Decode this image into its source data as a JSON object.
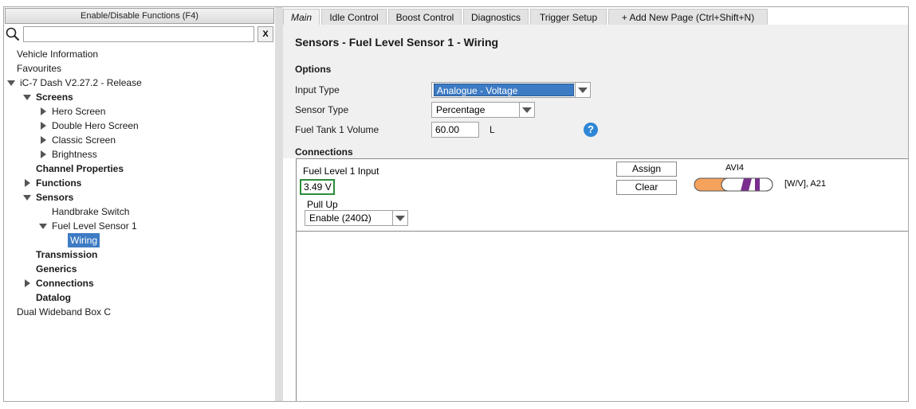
{
  "left_panel": {
    "enable_button": "Enable/Disable Functions (F4)",
    "search": {
      "value": "",
      "placeholder": ""
    },
    "clear_label": "X",
    "tree": [
      {
        "label": "Vehicle Information",
        "bold": false,
        "level": 0,
        "toggle": "none"
      },
      {
        "label": "Favourites",
        "bold": false,
        "level": 0,
        "toggle": "none"
      },
      {
        "label": "iC-7 Dash V2.27.2 - Release",
        "bold": false,
        "level": 0,
        "toggle": "expanded"
      },
      {
        "label": "Screens",
        "bold": true,
        "level": 1,
        "toggle": "expanded"
      },
      {
        "label": "Hero Screen",
        "bold": false,
        "level": 2,
        "toggle": "collapsed"
      },
      {
        "label": "Double Hero Screen",
        "bold": false,
        "level": 2,
        "toggle": "collapsed"
      },
      {
        "label": "Classic Screen",
        "bold": false,
        "level": 2,
        "toggle": "collapsed"
      },
      {
        "label": "Brightness",
        "bold": false,
        "level": 2,
        "toggle": "collapsed"
      },
      {
        "label": "Channel Properties",
        "bold": true,
        "level": 1,
        "toggle": "none"
      },
      {
        "label": "Functions",
        "bold": true,
        "level": 1,
        "toggle": "collapsed"
      },
      {
        "label": "Sensors",
        "bold": true,
        "level": 1,
        "toggle": "expanded"
      },
      {
        "label": "Handbrake Switch",
        "bold": false,
        "level": 2,
        "toggle": "none"
      },
      {
        "label": "Fuel Level Sensor 1",
        "bold": false,
        "level": 2,
        "toggle": "expanded"
      },
      {
        "label": "Wiring",
        "bold": false,
        "level": 3,
        "toggle": "none",
        "selected": true
      },
      {
        "label": "Transmission",
        "bold": true,
        "level": 1,
        "toggle": "none"
      },
      {
        "label": "Generics",
        "bold": true,
        "level": 1,
        "toggle": "none"
      },
      {
        "label": "Connections",
        "bold": true,
        "level": 1,
        "toggle": "collapsed"
      },
      {
        "label": "Datalog",
        "bold": true,
        "level": 1,
        "toggle": "none"
      },
      {
        "label": "Dual Wideband Box C",
        "bold": false,
        "level": 0,
        "toggle": "none"
      }
    ]
  },
  "tabs": [
    {
      "label": "Main",
      "active": true
    },
    {
      "label": "Idle Control",
      "active": false
    },
    {
      "label": "Boost Control",
      "active": false
    },
    {
      "label": "Diagnostics",
      "active": false
    },
    {
      "label": "Trigger Setup",
      "active": false
    },
    {
      "label": "+ Add New Page (Ctrl+Shift+N)",
      "active": false
    }
  ],
  "page": {
    "title": "Sensors - Fuel Level Sensor 1 - Wiring",
    "options_heading": "Options",
    "input_type": {
      "label": "Input Type",
      "value": "Analogue - Voltage"
    },
    "sensor_type": {
      "label": "Sensor Type",
      "value": "Percentage"
    },
    "tank_volume": {
      "label": "Fuel Tank 1 Volume",
      "value": "60.00",
      "unit": "L"
    },
    "help_icon": "?",
    "connections_heading": "Connections"
  },
  "connection": {
    "input_label": "Fuel Level 1 Input",
    "input_value": "3.49 V",
    "pullup_label": "Pull Up",
    "pullup_value": "Enable (240Ω)",
    "assign_label": "Assign",
    "clear_label": "Clear",
    "pin_name": "AVI4",
    "wire_desc": "[W/V], A21",
    "colors": {
      "wire_orange": "#f5a25c",
      "wire_violet": "#7b2d8f",
      "status_green": "#2c8c3a",
      "selection_blue": "#3d7bc4"
    }
  }
}
